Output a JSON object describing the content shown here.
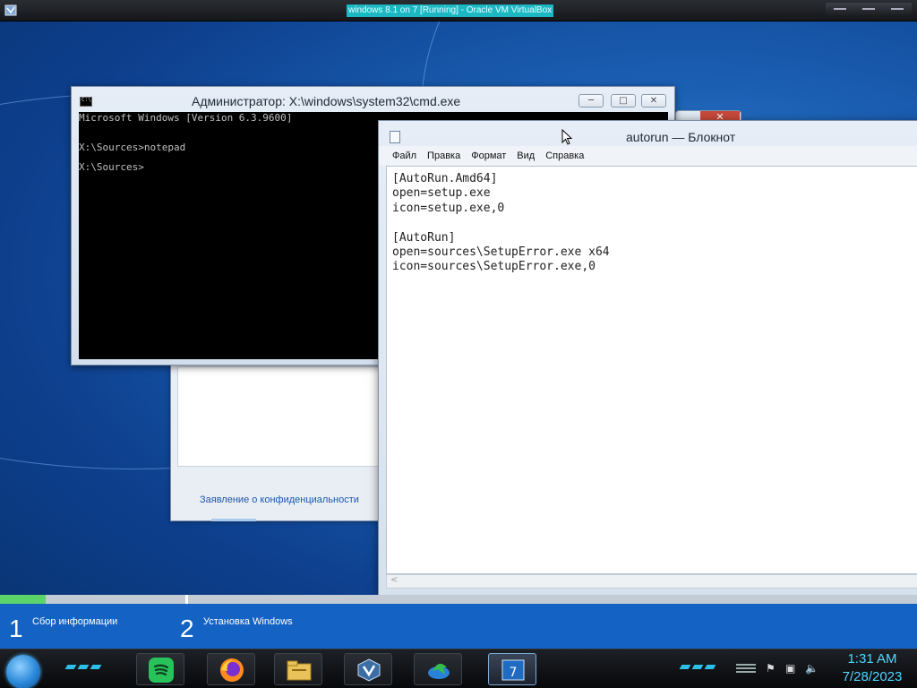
{
  "host": {
    "title": "windows 8.1 on 7 [Running] - Oracle VM VirtualBox"
  },
  "cmd": {
    "title": "Администратор: X:\\windows\\system32\\cmd.exe",
    "lines": [
      "Microsoft Windows [Version 6.3.9600]",
      "",
      "",
      "X:\\Sources>notepad",
      "",
      "X:\\Sources>"
    ],
    "minimize_label": "─",
    "maximize_label": "□",
    "close_label": "✕"
  },
  "notepad": {
    "title": "autorun — Блокнот",
    "menu": [
      "Файл",
      "Правка",
      "Формат",
      "Вид",
      "Справка"
    ],
    "content_lines": [
      "[AutoRun.Amd64]",
      "open=setup.exe",
      "icon=setup.exe,0",
      "",
      "[AutoRun]",
      "open=sources\\SetupError.exe x64",
      "icon=sources\\SetupError.exe,0"
    ],
    "hscroll_left": "<"
  },
  "setup": {
    "privacy_link": "Заявление о конфиденциальности",
    "close_label": "✕",
    "progress_fraction": 0.05,
    "steps": [
      {
        "number": "1",
        "label": "Сбор информации"
      },
      {
        "number": "2",
        "label": "Установка Windows"
      }
    ]
  },
  "taskbar": {
    "apps": [
      "spotify-icon",
      "firefox-icon",
      "file-explorer-icon",
      "virtualbox-icon",
      "download-manager-icon",
      "windows-7-icon"
    ],
    "time": "1:31 AM",
    "date": "7/28/2023"
  },
  "colors": {
    "desktop": "#1b5fb3",
    "progress": "#5bd46a",
    "clock": "#4fd8ff",
    "host_title_bg": "#1bb8c4"
  }
}
